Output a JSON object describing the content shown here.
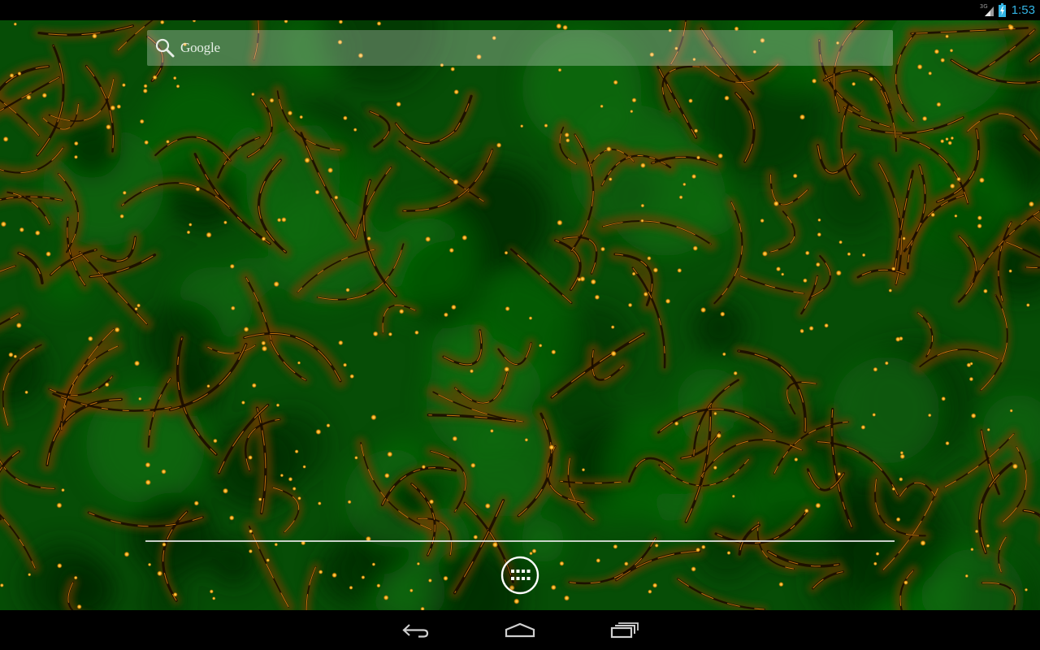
{
  "status_bar": {
    "network_type": "3G",
    "clock": "1:53",
    "icons": [
      "signal-icon",
      "battery-charging-icon"
    ],
    "accent_color": "#33b5e5"
  },
  "search": {
    "label": "Google",
    "icon": "search-icon"
  },
  "hotseat": {
    "all_apps_icon": "all-apps-icon"
  },
  "navigation": {
    "buttons": [
      "back-icon",
      "home-icon",
      "recent-apps-icon"
    ]
  },
  "wallpaper": {
    "base_color": "#064d06",
    "accent_color": "#f0a010"
  }
}
